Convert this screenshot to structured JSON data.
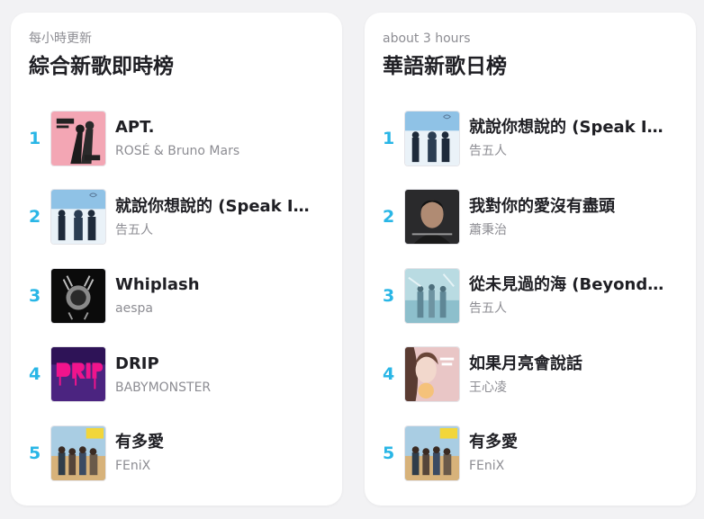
{
  "accent": "#29b6e6",
  "charts": [
    {
      "subtitle": "每小時更新",
      "title": "綜合新歌即時榜",
      "items": [
        {
          "rank": "1",
          "song": "APT.",
          "artist": "ROSÉ & Bruno Mars",
          "cover": "apt"
        },
        {
          "rank": "2",
          "song": "就說你想說的 (Speak It Out)",
          "artist": "告五人",
          "cover": "speak"
        },
        {
          "rank": "3",
          "song": "Whiplash",
          "artist": "aespa",
          "cover": "whiplash"
        },
        {
          "rank": "4",
          "song": "DRIP",
          "artist": "BABYMONSTER",
          "cover": "drip"
        },
        {
          "rank": "5",
          "song": "有多愛",
          "artist": "FEniX",
          "cover": "fenix"
        }
      ]
    },
    {
      "subtitle": "about 3 hours",
      "title": "華語新歌日榜",
      "items": [
        {
          "rank": "1",
          "song": "就說你想說的 (Speak It Out)",
          "artist": "告五人",
          "cover": "speak"
        },
        {
          "rank": "2",
          "song": "我對你的愛沒有盡頭",
          "artist": "蕭秉治",
          "cover": "portrait"
        },
        {
          "rank": "3",
          "song": "從未見過的海 (Beyond The Sea)",
          "artist": "告五人",
          "cover": "sea"
        },
        {
          "rank": "4",
          "song": "如果月亮會說話",
          "artist": "王心凌",
          "cover": "moon"
        },
        {
          "rank": "5",
          "song": "有多愛",
          "artist": "FEniX",
          "cover": "fenix"
        }
      ]
    }
  ]
}
